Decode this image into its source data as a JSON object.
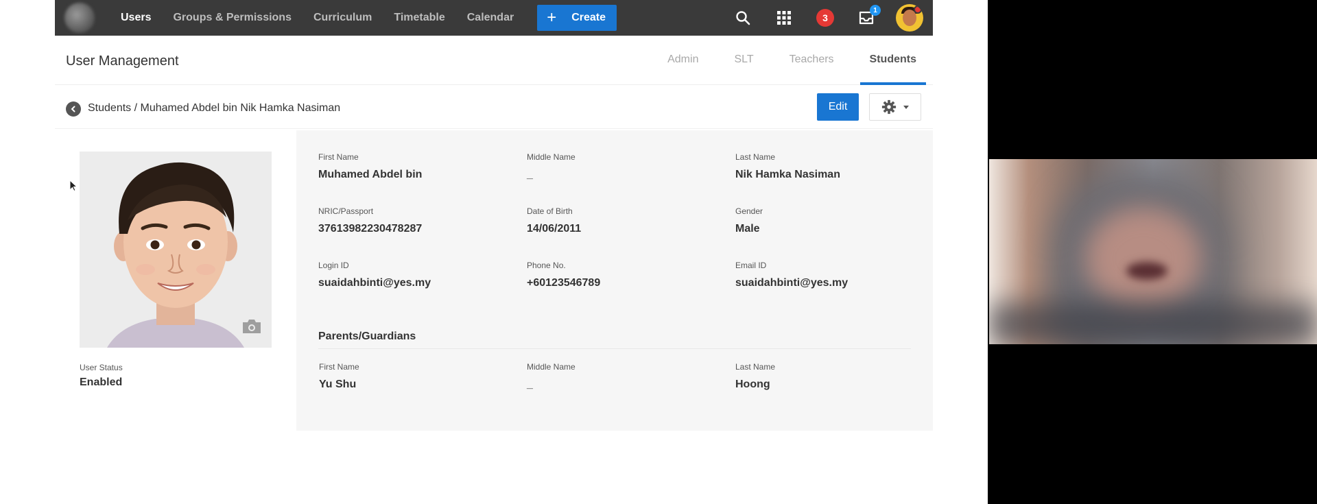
{
  "nav": {
    "items": [
      {
        "label": "Users",
        "active": true
      },
      {
        "label": "Groups & Permissions",
        "active": false
      },
      {
        "label": "Curriculum",
        "active": false
      },
      {
        "label": "Timetable",
        "active": false
      },
      {
        "label": "Calendar",
        "active": false
      }
    ],
    "create_label": "Create",
    "notification_count": "3",
    "inbox_count": "1"
  },
  "header": {
    "title": "User Management",
    "tabs": [
      {
        "label": "Admin",
        "active": false
      },
      {
        "label": "SLT",
        "active": false
      },
      {
        "label": "Teachers",
        "active": false
      },
      {
        "label": "Students",
        "active": true
      }
    ]
  },
  "breadcrumb": {
    "text": "Students / Muhamed Abdel bin Nik Hamka Nasiman",
    "edit_label": "Edit"
  },
  "profile": {
    "status_label": "User Status",
    "status_value": "Enabled"
  },
  "details": {
    "fields": [
      {
        "label": "First Name",
        "value": "Muhamed Abdel bin"
      },
      {
        "label": "Middle Name",
        "value": "_"
      },
      {
        "label": "Last Name",
        "value": "Nik Hamka Nasiman"
      },
      {
        "label": "NRIC/Passport",
        "value": "37613982230478287"
      },
      {
        "label": "Date of Birth",
        "value": "14/06/2011"
      },
      {
        "label": "Gender",
        "value": "Male"
      },
      {
        "label": "Login ID",
        "value": "suaidahbinti@yes.my"
      },
      {
        "label": "Phone No.",
        "value": "+60123546789"
      },
      {
        "label": "Email ID",
        "value": "suaidahbinti@yes.my"
      }
    ],
    "guardians_title": "Parents/Guardians",
    "guardians": [
      {
        "label": "First Name",
        "value": "Yu Shu"
      },
      {
        "label": "Middle Name",
        "value": "_"
      },
      {
        "label": "Last Name",
        "value": "Hoong"
      }
    ]
  },
  "colors": {
    "topbar": "#3a3a3a",
    "accent": "#1976d2",
    "badge": "#e53935"
  }
}
